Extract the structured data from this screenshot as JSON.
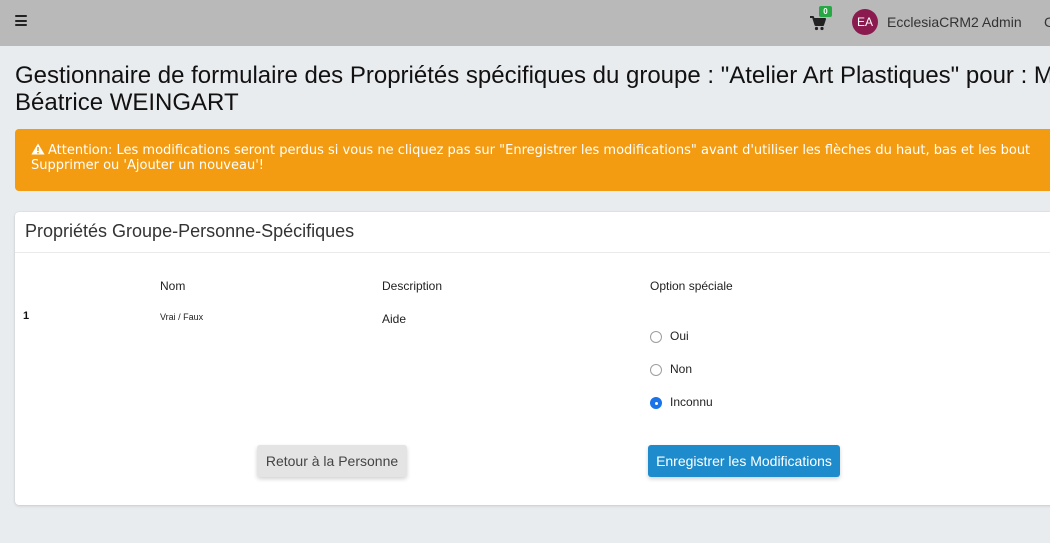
{
  "navbar": {
    "cart_count": "0",
    "avatar_initials": "EA",
    "username": "EcclesiaCRM2 Admin",
    "edge_text": "C",
    "icons": [
      "hamburger-menu-icon",
      "shopping-cart-icon"
    ]
  },
  "page": {
    "title_line1": "Gestionnaire de formulaire des Propriétés spécifiques du groupe : \"Atelier Art Plastiques\" pour : M",
    "title_line2": "Béatrice WEINGART"
  },
  "alert": {
    "line1": "Attention: Les modifications seront perdus si vous ne cliquez pas sur \"Enregistrer les modifications\" avant d'utiliser les flèches du haut, bas et les bout",
    "line2": "Supprimer ou 'Ajouter un nouveau'!",
    "color": "#f39c12"
  },
  "card": {
    "title": "Propriétés Groupe-Personne-Spécifiques",
    "columns": {
      "nom": "Nom",
      "description": "Description",
      "option": "Option spéciale"
    },
    "rows": [
      {
        "num": "1",
        "nom": "Vrai / Faux",
        "description": "Aide",
        "options": [
          {
            "label": "Oui",
            "checked": false
          },
          {
            "label": "Non",
            "checked": false
          },
          {
            "label": "Inconnu",
            "checked": true
          }
        ]
      }
    ],
    "buttons": {
      "back": "Retour à la Personne",
      "save": "Enregistrer les Modifications"
    }
  },
  "colors": {
    "topbar": "#b9b9b9",
    "primary": "#1e8ccc",
    "avatar": "#8b1a4f",
    "badge": "#28a745"
  }
}
